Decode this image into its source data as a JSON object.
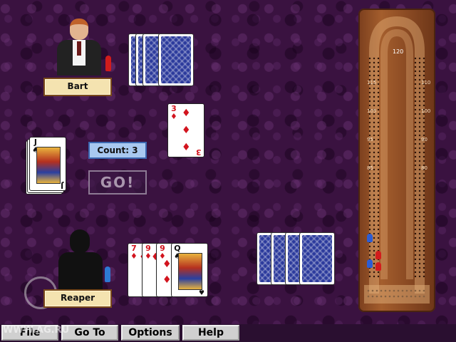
{
  "players": {
    "opponent": {
      "name": "Bart"
    },
    "human": {
      "name": "Reaper"
    }
  },
  "count": {
    "label": "Count: 3"
  },
  "go_button": {
    "label": "GO!"
  },
  "cut_card": {
    "rank": "J",
    "suit": "♠"
  },
  "played_card": {
    "rank": "3",
    "suit": "♦"
  },
  "human_hand": [
    {
      "rank": "7",
      "suit": "♦"
    },
    {
      "rank": "9",
      "suit": "♦"
    },
    {
      "rank": "9",
      "suit": "♦"
    },
    {
      "rank": "Q",
      "suit": "♠"
    }
  ],
  "board_labels": [
    "120",
    "115",
    "110",
    "105",
    "100",
    "95",
    "90",
    "85",
    "80"
  ],
  "menu": {
    "file": "File",
    "goto": "Go To",
    "options": "Options",
    "help": "Help"
  },
  "watermark": "WWW.AG.RU",
  "colors": {
    "table": "#3a1240",
    "card_back": "#2b3a9c",
    "red_suit": "#d2141e",
    "peg_red": "#d21c1c",
    "peg_blue": "#2d5dd4",
    "board_wood": "#a45e2d"
  }
}
